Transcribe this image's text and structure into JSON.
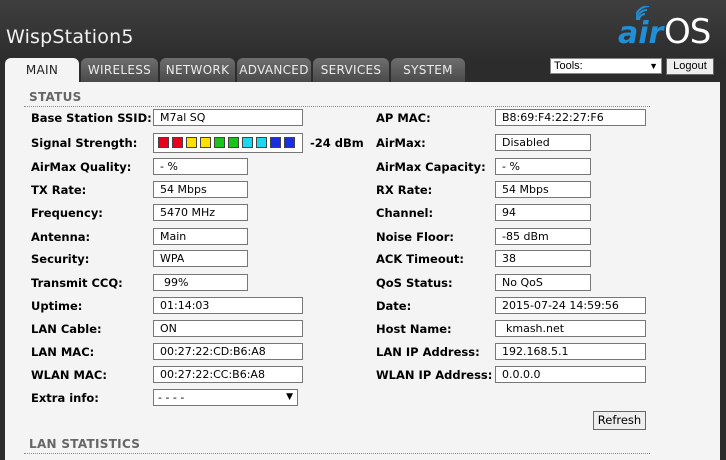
{
  "header": {
    "device_name": "WispStation5",
    "logo_left": "air",
    "logo_right": "OS"
  },
  "tabs": [
    {
      "label": "MAIN"
    },
    {
      "label": "WIRELESS"
    },
    {
      "label": "NETWORK"
    },
    {
      "label": "ADVANCED"
    },
    {
      "label": "SERVICES"
    },
    {
      "label": "SYSTEM"
    }
  ],
  "tools": {
    "selected": "Tools:"
  },
  "logout_label": "Logout",
  "status": {
    "title": "STATUS",
    "left": [
      {
        "label": "Base Station SSID:",
        "value": "M7al SQ"
      },
      {
        "label": "Signal Strength:",
        "value": "-24 dBm"
      },
      {
        "label": "AirMax Quality:",
        "value": "- %"
      },
      {
        "label": "TX Rate:",
        "value": "54 Mbps"
      },
      {
        "label": "Frequency:",
        "value": "5470 MHz"
      },
      {
        "label": "Antenna:",
        "value": "Main"
      },
      {
        "label": "Security:",
        "value": "WPA"
      },
      {
        "label": "Transmit CCQ:",
        "value": "99%"
      },
      {
        "label": "Uptime:",
        "value": "01:14:03"
      },
      {
        "label": "LAN Cable:",
        "value": "ON"
      },
      {
        "label": "LAN MAC:",
        "value": "00:27:22:CD:B6:A8"
      },
      {
        "label": "WLAN MAC:",
        "value": "00:27:22:CC:B6:A8"
      },
      {
        "label": "Extra info:",
        "value": "- - - -"
      }
    ],
    "right": [
      {
        "label": "AP MAC:",
        "value": "B8:69:F4:22:27:F6"
      },
      {
        "label": "AirMax:",
        "value": "Disabled"
      },
      {
        "label": "AirMax Capacity:",
        "value": "- %"
      },
      {
        "label": "RX Rate:",
        "value": "54 Mbps"
      },
      {
        "label": "Channel:",
        "value": "94"
      },
      {
        "label": "Noise Floor:",
        "value": "-85 dBm"
      },
      {
        "label": "ACK Timeout:",
        "value": "38"
      },
      {
        "label": "QoS Status:",
        "value": "No QoS"
      },
      {
        "label": "Date:",
        "value": "2015-07-24 14:59:56"
      },
      {
        "label": "Host Name:",
        "value": "kmash.net"
      },
      {
        "label": "LAN IP Address:",
        "value": "192.168.5.1"
      },
      {
        "label": "WLAN IP Address:",
        "value": "0.0.0.0"
      }
    ],
    "signal_colors": [
      "#e8001c",
      "#e8001c",
      "#ffe000",
      "#ffe000",
      "#19c41c",
      "#19c41c",
      "#1cd8ee",
      "#1cd8ee",
      "#1a2fe0",
      "#1a2fe0"
    ],
    "refresh_label": "Refresh"
  },
  "lan_statistics": {
    "title": "LAN STATISTICS"
  }
}
